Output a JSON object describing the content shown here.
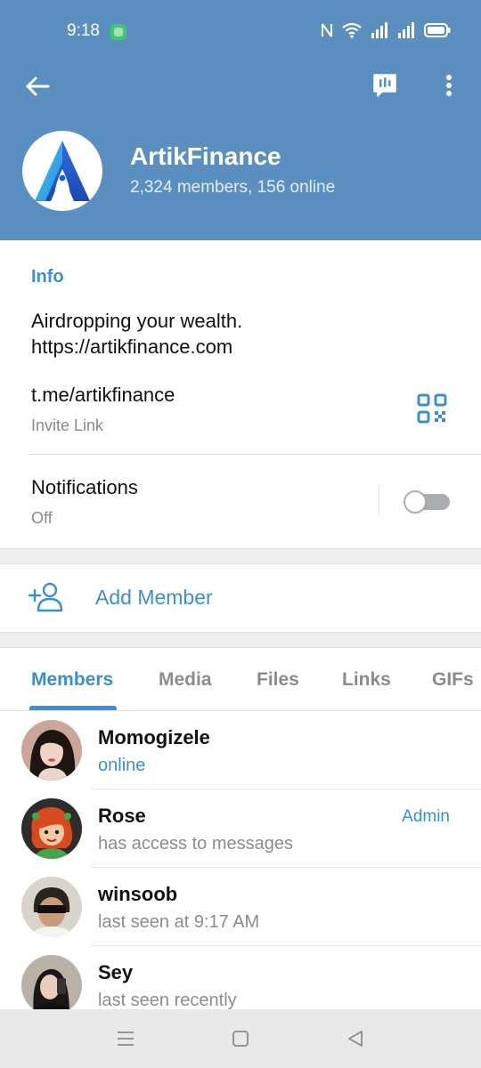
{
  "status_bar": {
    "time": "9:18",
    "icons": [
      "app-notification-icon",
      "nfc-icon",
      "wifi-icon",
      "signal-icon",
      "signal-icon",
      "battery-icon"
    ]
  },
  "toolbar": {
    "back_icon": "arrow-left-icon",
    "voice_chat_icon": "voice-chat-icon",
    "more_icon": "more-vertical-icon"
  },
  "group": {
    "name": "ArtikFinance",
    "subtitle": "2,324 members, 156 online",
    "avatar_icon": "artikfinance-logo"
  },
  "info": {
    "title": "Info",
    "about_lines": [
      "Airdropping your wealth.",
      "https://artikfinance.com"
    ],
    "link": "t.me/artikfinance",
    "link_caption": "Invite Link",
    "qr_icon": "qr-code-icon",
    "notifications_label": "Notifications",
    "notifications_state": "Off",
    "notifications_enabled": false
  },
  "add_member": {
    "label": "Add Member",
    "icon": "add-user-icon"
  },
  "tabs": [
    {
      "label": "Members",
      "active": true
    },
    {
      "label": "Media",
      "active": false
    },
    {
      "label": "Files",
      "active": false
    },
    {
      "label": "Links",
      "active": false
    },
    {
      "label": "GIFs",
      "active": false
    }
  ],
  "members": [
    {
      "name": "Momogizele",
      "status": "online",
      "online": true,
      "badge": ""
    },
    {
      "name": "Rose",
      "status": "has access to messages",
      "online": false,
      "badge": "Admin"
    },
    {
      "name": "winsoob",
      "status": "last seen at 9:17 AM",
      "online": false,
      "badge": ""
    },
    {
      "name": "Sey",
      "status": "last seen recently",
      "online": false,
      "badge": ""
    }
  ],
  "nav_bar": {
    "icons": [
      "menu-icon",
      "home-icon",
      "back-triangle-icon"
    ]
  },
  "colors": {
    "header": "#5a8fc0",
    "accent": "#3c8fcf",
    "secondary_text": "#8c8c8c"
  }
}
